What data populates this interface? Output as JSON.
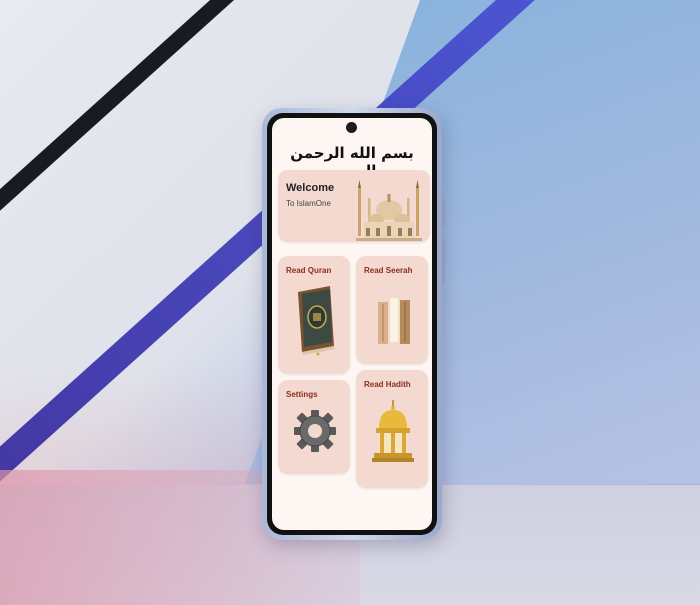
{
  "basmala": "بسم الله الرحمن الرحيم",
  "welcome": {
    "title": "Welcome",
    "subtitle": "To IslamOne"
  },
  "menu": {
    "quran": "Read Quran",
    "seerah": "Read Seerah",
    "settings": "Settings",
    "hadith": "Read Hadith"
  },
  "icons": {
    "welcome": "mosque-icon",
    "quran": "quran-book-icon",
    "seerah": "books-icon",
    "settings": "gear-icon",
    "hadith": "lantern-dome-icon"
  },
  "colors": {
    "card_bg": "#f3d9d0",
    "label_accent": "#8b2f1f",
    "screen_bg": "#fdf6f2"
  }
}
